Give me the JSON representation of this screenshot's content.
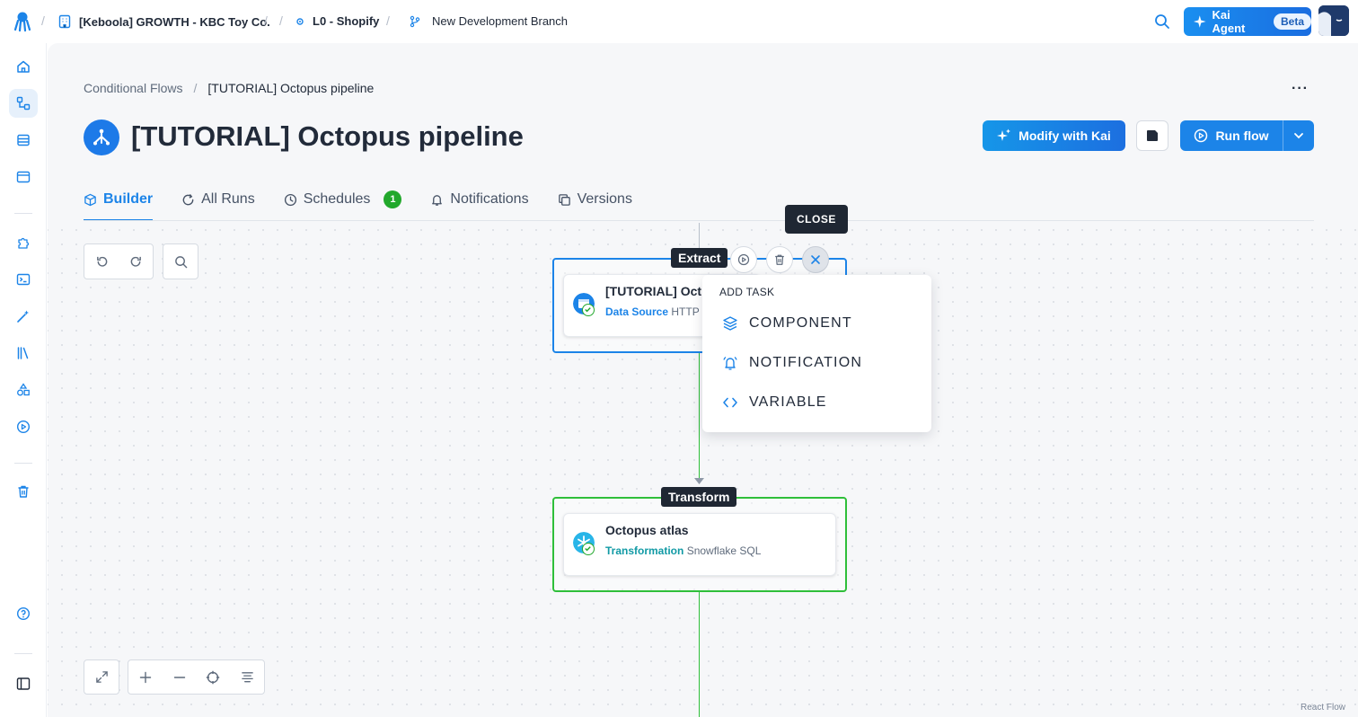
{
  "topbar": {
    "org": "[Keboola] GROWTH - KBC Toy Co.",
    "project": "L0 - Shopify",
    "branch": "New Development Branch",
    "kai_agent_label": "Kai Agent",
    "beta_label": "Beta"
  },
  "breadcrumb": {
    "parent": "Conditional Flows",
    "separator": "/",
    "current": "[TUTORIAL] Octopus pipeline"
  },
  "page": {
    "title": "[TUTORIAL] Octopus pipeline",
    "more_label": "···"
  },
  "actions": {
    "modify_label": "Modify with Kai",
    "run_label": "Run flow"
  },
  "tabs": [
    {
      "label": "Builder",
      "active": true
    },
    {
      "label": "All Runs"
    },
    {
      "label": "Schedules",
      "badge": "1"
    },
    {
      "label": "Notifications"
    },
    {
      "label": "Versions"
    }
  ],
  "flow": {
    "phases": [
      {
        "label": "Extract",
        "task": {
          "name": "[TUTORIAL] Oct",
          "type": "Data Source",
          "component": "HTTP"
        }
      },
      {
        "label": "Transform",
        "task": {
          "name": "Octopus atlas",
          "type": "Transformation",
          "component": "Snowflake SQL"
        }
      }
    ],
    "tooltip": "CLOSE"
  },
  "add_task_menu": {
    "heading": "ADD TASK",
    "items": [
      "COMPONENT",
      "NOTIFICATION",
      "VARIABLE"
    ]
  },
  "footer": {
    "attribution": "React Flow"
  },
  "colors": {
    "accent": "#1c84e8",
    "extract_border": "#1c84e8",
    "transform_border": "#2fbf3a",
    "success": "#22a82c"
  }
}
